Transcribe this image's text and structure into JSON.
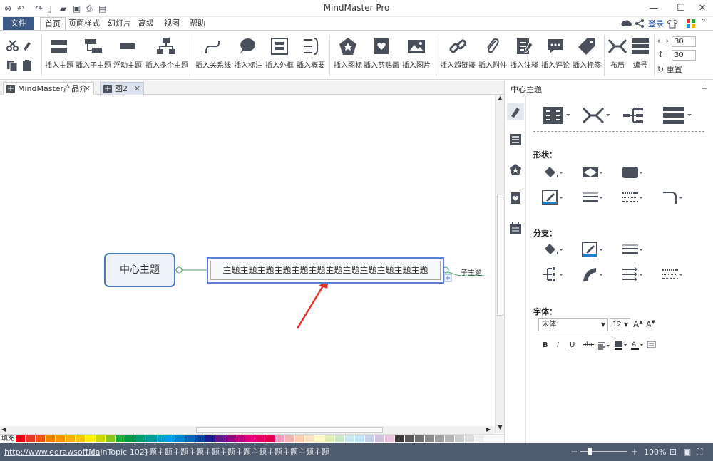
{
  "app": {
    "title": "MindMaster Pro",
    "login": "登录"
  },
  "menu": {
    "file": "文件",
    "tabs": [
      "首页",
      "页面样式",
      "幻灯片",
      "高级",
      "视图",
      "帮助"
    ]
  },
  "ribbon": {
    "buttons": [
      {
        "label": "插入主题",
        "icon": "insert-topic-icon"
      },
      {
        "label": "插入子主题",
        "icon": "insert-subtopic-icon"
      },
      {
        "label": "浮动主题",
        "icon": "floating-topic-icon"
      },
      {
        "label": "插入多个主题",
        "icon": "insert-multiple-topics-icon"
      },
      {
        "label": "插入关系线",
        "icon": "relationship-line-icon"
      },
      {
        "label": "插入标注",
        "icon": "callout-icon"
      },
      {
        "label": "插入外框",
        "icon": "boundary-icon"
      },
      {
        "label": "插入概要",
        "icon": "summary-icon"
      },
      {
        "label": "插入图标",
        "icon": "insert-icon-icon"
      },
      {
        "label": "插入剪贴画",
        "icon": "clipart-icon"
      },
      {
        "label": "插入图片",
        "icon": "picture-icon"
      },
      {
        "label": "插入超链接",
        "icon": "hyperlink-icon"
      },
      {
        "label": "插入附件",
        "icon": "attachment-icon"
      },
      {
        "label": "插入注释",
        "icon": "note-icon"
      },
      {
        "label": "插入评论",
        "icon": "comment-icon"
      },
      {
        "label": "插入标签",
        "icon": "tag-icon"
      },
      {
        "label": "布局",
        "icon": "layout-icon"
      },
      {
        "label": "编号",
        "icon": "numbering-icon"
      }
    ],
    "spacing_h": "30",
    "spacing_v": "30",
    "reset": "重置"
  },
  "doc_tabs": [
    {
      "label": "MindMaster产品介绍",
      "active": true
    },
    {
      "label": "图2",
      "active": false
    }
  ],
  "mindmap": {
    "center": "中心主题",
    "main_topic": "主题主题主题主题主题主题主题主题主题主题主题主题",
    "sub_topic": "子主题"
  },
  "panel": {
    "title": "中心主题",
    "shape_label": "形状：",
    "branch_label": "分支：",
    "font_label": "字体：",
    "font_family": "宋体",
    "font_size": "12",
    "font_buttons": [
      "B",
      "I",
      "U",
      "abc"
    ]
  },
  "palette": {
    "fill_label": "填充",
    "colors": [
      "#e60012",
      "#e83828",
      "#ea5514",
      "#f08300",
      "#f39800",
      "#f8b500",
      "#fcc800",
      "#fff100",
      "#cfdb00",
      "#8fc31f",
      "#22ac38",
      "#009944",
      "#009b6b",
      "#009e96",
      "#00a0c1",
      "#00a0e9",
      "#0086d1",
      "#0068b7",
      "#00479d",
      "#1d2088",
      "#601986",
      "#920783",
      "#be0081",
      "#e4007f",
      "#e5006a",
      "#e5004f",
      "#f19ec2",
      "#f5b2b2",
      "#facdae",
      "#fce2c4",
      "#fffbc7",
      "#e0ecb4",
      "#cce6c8",
      "#c9e8ed",
      "#bfe3f8",
      "#c5d0ea",
      "#d1c0dd",
      "#e8c3dc",
      "#3e3a39",
      "#595757",
      "#727171",
      "#898989",
      "#9fa0a0",
      "#b5b5b6",
      "#c9caca",
      "#dcdddd",
      "#efefef"
    ]
  },
  "statusbar": {
    "url": "http://www.edrawsoft.cn",
    "topic_id": "[MainTopic 102]",
    "topic_text": "主题主题主题主题主题主题主题主题主题主题主题主题",
    "zoom": "100%"
  },
  "colors": {
    "accent": "#3d5a86",
    "selection": "#5b7fd3",
    "arrow": "#e8332a",
    "statusbar": "#4f5b6e"
  }
}
